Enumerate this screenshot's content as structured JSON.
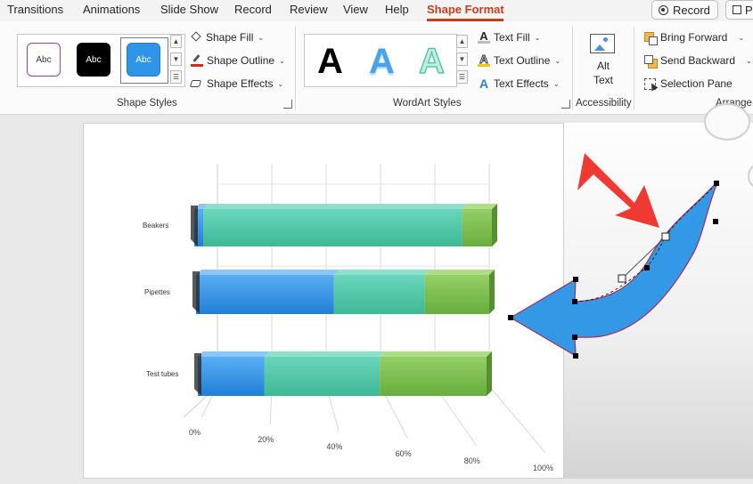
{
  "menu": {
    "items": [
      "Transitions",
      "Animations",
      "Slide Show",
      "Record",
      "Review",
      "View",
      "Help",
      "Shape Format"
    ],
    "active": "Shape Format",
    "record_button": "Record",
    "present_button_partial": "P"
  },
  "ribbon": {
    "shape_styles": {
      "thumbs": [
        "Abc",
        "Abc",
        "Abc"
      ],
      "commands": [
        "Shape Fill",
        "Shape Outline",
        "Shape Effects"
      ],
      "label": "Shape Styles"
    },
    "wordart_styles": {
      "letters": [
        "A",
        "A",
        "A"
      ],
      "commands": [
        "Text Fill",
        "Text Outline",
        "Text Effects"
      ],
      "label": "WordArt Styles"
    },
    "accessibility": {
      "alt_text_line1": "Alt",
      "alt_text_line2": "Text",
      "label": "Accessibility"
    },
    "arrange": {
      "commands": [
        "Bring Forward",
        "Send Backward",
        "Selection Pane"
      ],
      "label": "Arrange"
    }
  },
  "colors": {
    "accent": "#c43e1c",
    "blue": "#2e8fe8",
    "teal": "#4cc9a8",
    "green": "#7cbf4f",
    "arrow_fill": "#3399e6",
    "arrow_outline": "#9b3a6a",
    "red_arrow": "#ef3a33"
  },
  "chart_data": {
    "type": "bar",
    "stacked": true,
    "percent": true,
    "categories": [
      "Beakers",
      "Pipettes",
      "Test tubes"
    ],
    "series": [
      {
        "values": [
          0.03,
          0.47,
          0.23
        ]
      },
      {
        "values": [
          0.87,
          0.31,
          0.4
        ]
      },
      {
        "values": [
          0.1,
          0.22,
          0.37
        ]
      }
    ],
    "x_tick_labels": [
      "0%",
      "20%",
      "40%",
      "60%",
      "80%",
      "100%"
    ],
    "xlim": [
      0,
      1
    ],
    "grid": true,
    "legend": "none",
    "style": "3d"
  }
}
